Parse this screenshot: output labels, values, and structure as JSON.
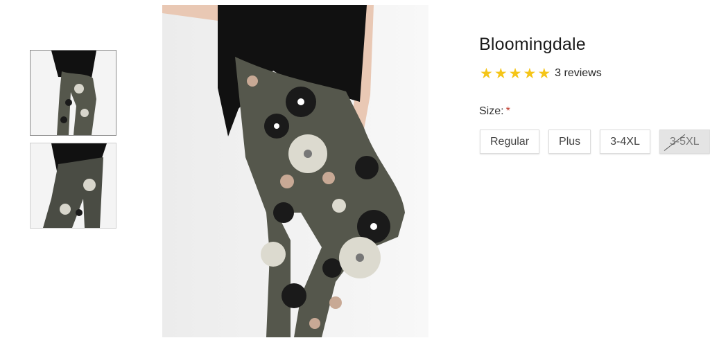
{
  "product": {
    "title": "Bloomingdale",
    "rating_stars": "★",
    "rating_value": 5,
    "review_count": "3 reviews"
  },
  "size": {
    "label": "Size:",
    "required_marker": "*",
    "options": [
      "Regular",
      "Plus",
      "3-4XL",
      "3-5XL"
    ],
    "unavailable": [
      "3-5XL"
    ]
  },
  "gallery": {
    "selected_index": 0,
    "thumbnail_count": 2
  },
  "colors": {
    "star": "#f5c518",
    "required": "#c0392b",
    "legging": "#55574c",
    "top": "#111111"
  }
}
